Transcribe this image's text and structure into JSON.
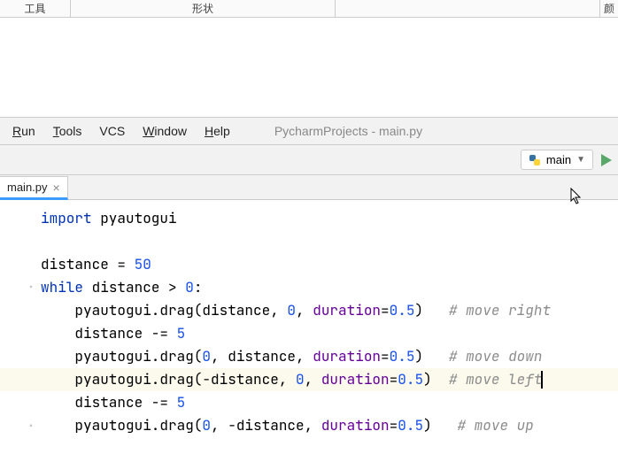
{
  "top_tabs": {
    "tools": "工具",
    "shape": "形状",
    "colors": "颜"
  },
  "menubar": {
    "run": "Run",
    "tools": "Tools",
    "vcs": "VCS",
    "window": "Window",
    "help": "Help"
  },
  "project_title": "PycharmProjects - main.py",
  "run_config": {
    "label": "main"
  },
  "file_tab": {
    "name": "main.py"
  },
  "code": {
    "l1_import": "import",
    "l1_mod": " pyautogui",
    "l3_a": "distance = ",
    "l3_n": "50",
    "l4_kw": "while",
    "l4_a": " distance > ",
    "l4_n": "0",
    "l4_b": ":",
    "l5_a": "    pyautogui.drag(distance, ",
    "l5_n": "0",
    "l5_b": ", ",
    "l5_kw": "duration",
    "l5_c": "=",
    "l5_d": "0.5",
    "l5_e": ")",
    "l5_cmt": "   # move right",
    "l6_a": "    distance -= ",
    "l6_n": "5",
    "l7_a": "    pyautogui.drag(",
    "l7_n1": "0",
    "l7_b": ", distance, ",
    "l7_kw": "duration",
    "l7_c": "=",
    "l7_d": "0.5",
    "l7_e": ")",
    "l7_cmt": "   # move down",
    "l8_a": "    pyautogui.drag(-distance, ",
    "l8_n": "0",
    "l8_b": ", ",
    "l8_kw": "duration",
    "l8_c": "=",
    "l8_d": "0.5",
    "l8_e": ")",
    "l8_cmt": "  # move left",
    "l9_a": "    distance -= ",
    "l9_n": "5",
    "l10_a": "    pyautogui.drag(",
    "l10_n1": "0",
    "l10_b": ", -distance, ",
    "l10_kw": "duration",
    "l10_c": "=",
    "l10_d": "0.5",
    "l10_e": ")",
    "l10_cmt": "   # move up"
  }
}
